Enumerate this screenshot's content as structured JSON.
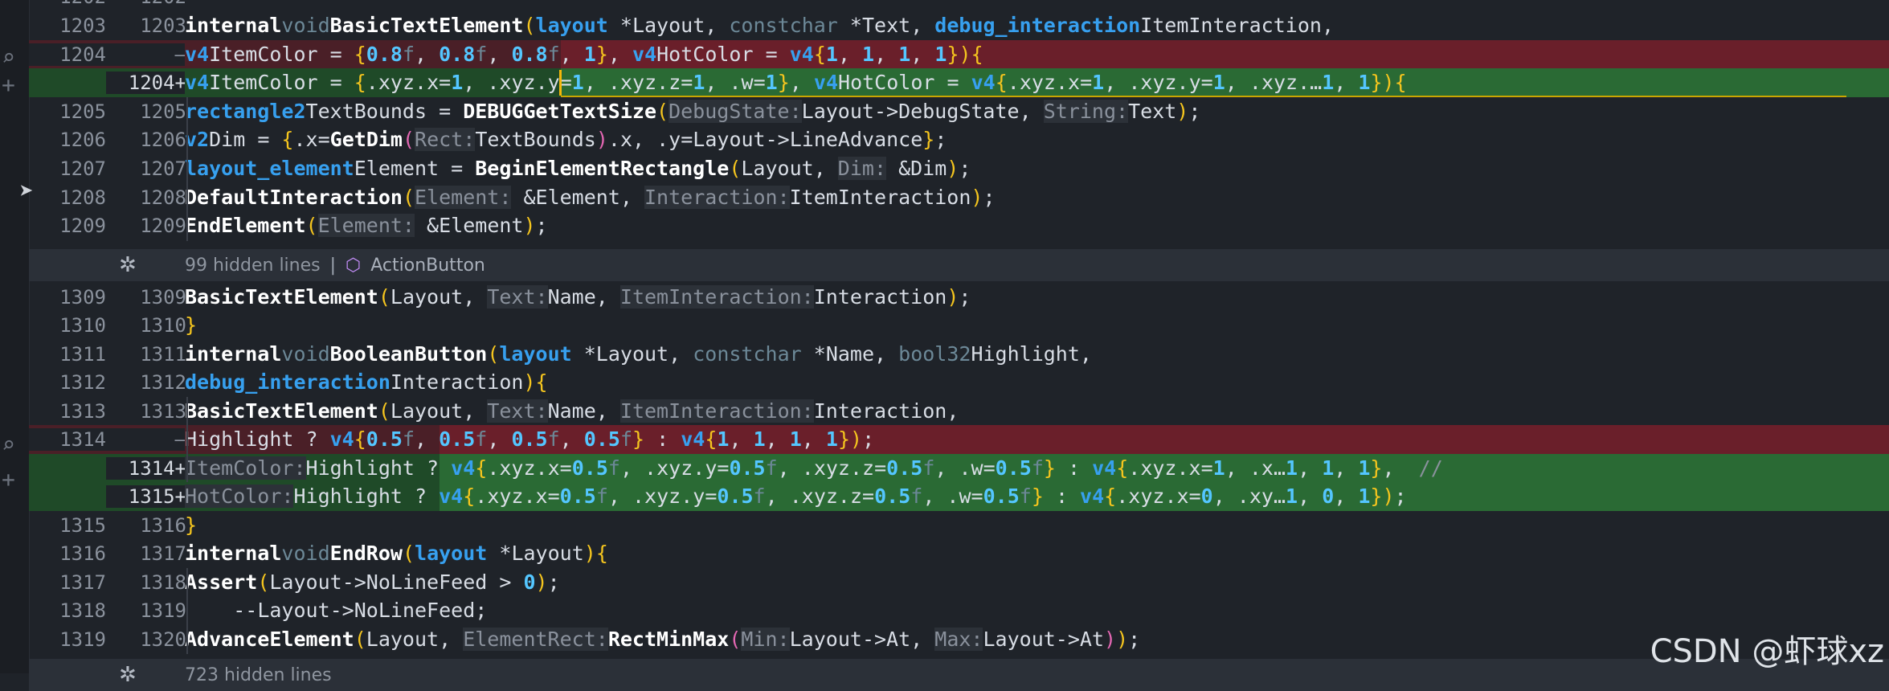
{
  "cursor_icon": "mouse-pointer-icon",
  "gutter_icons": [
    "diff-toggle-icon",
    "diff-add-icon",
    "diff-toggle-icon",
    "diff-add-icon"
  ],
  "lines": [
    {
      "left": "1202",
      "right": "1202",
      "kind": "ctx",
      "code": ""
    },
    {
      "left": "1203",
      "right": "1203",
      "kind": "ctx",
      "code": "internal void BasicTextElement(layout *Layout, const char *Text, debug_interaction ItemInteraction,"
    },
    {
      "left": "1204",
      "right": "—",
      "kind": "del",
      "code": "                               v4 ItemColor = {0.8f, 0.8f, 0.8f, 1}, v4 HotColor = v4{1, 1, 1, 1}) {"
    },
    {
      "left": "",
      "right": "1204+",
      "kind": "add",
      "code": "                               v4 ItemColor = {.xyz.x=1, .xyz.y=1, .xyz.z=1, .w=1}, v4 HotColor = v4{.xyz.x=1, .xyz.y=1, .xyz.…1, 1}) {"
    },
    {
      "left": "1205",
      "right": "1205",
      "kind": "ctx",
      "code": "    rectangle2 TextBounds = DEBUGGetTextSize(DebugState: Layout->DebugState, String: Text);"
    },
    {
      "left": "1206",
      "right": "1206",
      "kind": "ctx",
      "code": "    v2 Dim = {.x=GetDim(Rect: TextBounds).x, .y=Layout->LineAdvance};"
    },
    {
      "left": "1207",
      "right": "1207",
      "kind": "ctx",
      "code": "    layout_element Element = BeginElementRectangle(Layout, Dim: &Dim);"
    },
    {
      "left": "1208",
      "right": "1208",
      "kind": "ctx",
      "code": "    DefaultInteraction(Element: &Element, Interaction: ItemInteraction);"
    },
    {
      "left": "1209",
      "right": "1209",
      "kind": "ctx",
      "code": "    EndElement(Element: &Element);"
    },
    {
      "left": "1309",
      "right": "1309",
      "kind": "ctx",
      "code": "    BasicTextElement(Layout, Text: Name, ItemInteraction: Interaction);"
    },
    {
      "left": "1310",
      "right": "1310",
      "kind": "ctx",
      "code": "}"
    },
    {
      "left": "1311",
      "right": "1311",
      "kind": "ctx",
      "code": "internal void BooleanButton(layout *Layout, const char *Name, bool32 Highlight,"
    },
    {
      "left": "1312",
      "right": "1312",
      "kind": "ctx",
      "code": "                            debug_interaction Interaction) {"
    },
    {
      "left": "1313",
      "right": "1313",
      "kind": "ctx",
      "code": "    BasicTextElement(Layout, Text: Name, ItemInteraction: Interaction,"
    },
    {
      "left": "1314",
      "right": "—",
      "kind": "del",
      "code": "                     Highlight ? v4{0.5f, 0.5f, 0.5f, 0.5f} : v4{1, 1, 1, 1});"
    },
    {
      "left": "",
      "right": "1314+",
      "kind": "add",
      "code": "                     ItemColor: Highlight ? v4{.xyz.x=0.5f, .xyz.y=0.5f, .xyz.z=0.5f, .w=0.5f} : v4{.xyz.x=1, .x…1, 1, 1},  //"
    },
    {
      "left": "",
      "right": "1315+",
      "kind": "add",
      "code": "                     HotColor: Highlight ? v4{.xyz.x=0.5f, .xyz.y=0.5f, .xyz.z=0.5f, .w=0.5f} : v4{.xyz.x=0, .xy…1, 0, 1});"
    },
    {
      "left": "1315",
      "right": "1316",
      "kind": "ctx",
      "code": "}"
    },
    {
      "left": "1316",
      "right": "1317",
      "kind": "ctx",
      "code": "internal void EndRow(layout *Layout) {"
    },
    {
      "left": "1317",
      "right": "1318",
      "kind": "ctx",
      "code": "    Assert(Layout->NoLineFeed > 0);"
    },
    {
      "left": "1318",
      "right": "1319",
      "kind": "ctx",
      "code": "    --Layout->NoLineFeed;"
    },
    {
      "left": "1319",
      "right": "1320",
      "kind": "ctx",
      "code": "    AdvanceElement(Layout, ElementRect: RectMinMax(Min: Layout->At, Max: Layout->At));"
    }
  ],
  "folds": [
    {
      "icon": "fold-expand-icon",
      "text": "99 hidden lines",
      "separator": "|",
      "symbol_icon": "cube-icon",
      "symbol": "ActionButton"
    },
    {
      "icon": "fold-expand-icon",
      "text": "723 hidden lines",
      "separator": "",
      "symbol_icon": "",
      "symbol": ""
    }
  ],
  "watermark": "CSDN @虾球xz"
}
